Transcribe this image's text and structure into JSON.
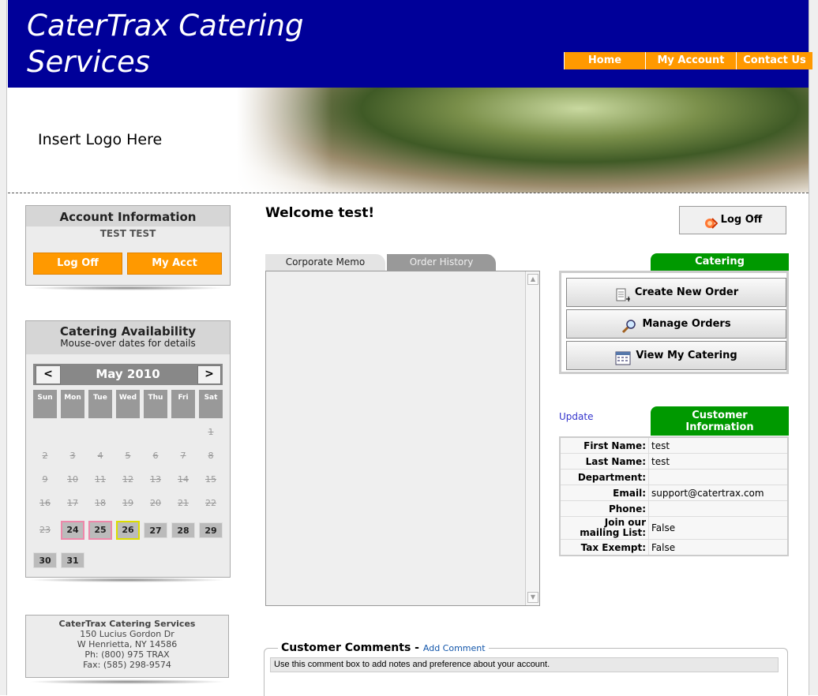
{
  "header": {
    "title_line1": "CaterTrax Catering",
    "title_line2": "Services",
    "nav": [
      {
        "label": "Home"
      },
      {
        "label": "My Account"
      },
      {
        "label": "Contact Us"
      }
    ],
    "nav_color": "#ff9900",
    "bg_color": "#000099"
  },
  "banner": {
    "logo_placeholder": "Insert Logo Here"
  },
  "account": {
    "heading": "Account Information",
    "user_name": "TEST TEST",
    "logoff_label": "Log Off",
    "myacct_label": "My Acct"
  },
  "availability": {
    "heading": "Catering Availability",
    "subheading": "Mouse-over dates for details",
    "month": "May 2010",
    "prev_label": "<",
    "next_label": ">",
    "weekdays": [
      "Sun",
      "Mon",
      "Tue",
      "Wed",
      "Thu",
      "Fri",
      "Sat"
    ],
    "past_days": [
      "1",
      "2",
      "3",
      "4",
      "5",
      "6",
      "7",
      "8",
      "9",
      "10",
      "11",
      "12",
      "13",
      "14",
      "15",
      "16",
      "17",
      "18",
      "19",
      "20",
      "21",
      "22",
      "23"
    ],
    "open_days": [
      "24",
      "25",
      "26",
      "27",
      "28",
      "29",
      "30",
      "31"
    ]
  },
  "address": {
    "company": "CaterTrax Catering Services",
    "street": "150 Lucius Gordon Dr",
    "city": "W Henrietta, NY 14586",
    "phone": "Ph: (800) 975 TRAX",
    "fax": "Fax: (585) 298-9574"
  },
  "main": {
    "welcome": "Welcome test!",
    "logoff_label": "Log Off",
    "tabs": [
      {
        "label": "Corporate Memo",
        "active": true
      },
      {
        "label": "Order History",
        "active": false
      }
    ]
  },
  "catering": {
    "tab_label": "Catering",
    "buttons": [
      {
        "label": "Create New Order",
        "icon": "new-document-icon"
      },
      {
        "label": "Manage Orders",
        "icon": "magnifier-icon"
      },
      {
        "label": "View My Catering",
        "icon": "calendar-icon"
      }
    ]
  },
  "customer": {
    "update_label": "Update",
    "tab_line1": "Customer",
    "tab_line2": "Information",
    "fields": [
      {
        "label": "First Name:",
        "value": "test"
      },
      {
        "label": "Last Name:",
        "value": "test"
      },
      {
        "label": "Department:",
        "value": ""
      },
      {
        "label": "Email:",
        "value": "support@catertrax.com"
      },
      {
        "label": "Phone:",
        "value": ""
      },
      {
        "label": "Join our mailing List:",
        "value": "False"
      },
      {
        "label": "Tax Exempt:",
        "value": "False"
      }
    ]
  },
  "comments": {
    "title": "Customer Comments",
    "separator": " - ",
    "add_label": "Add Comment",
    "note": "Use this comment box to add notes and preference about your account."
  }
}
